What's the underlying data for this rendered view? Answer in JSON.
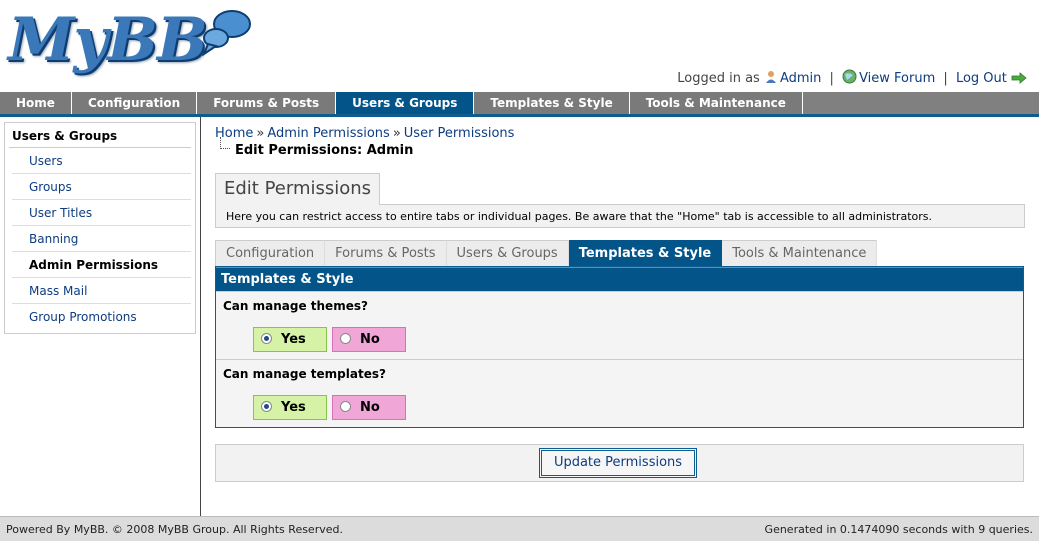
{
  "header": {
    "logo_text": "MyBB",
    "logged_in_as": "Logged in as",
    "user_link": "Admin",
    "view_forum": "View Forum",
    "log_out": "Log Out",
    "separator": "|"
  },
  "menu": {
    "items": [
      {
        "label": "Home"
      },
      {
        "label": "Configuration"
      },
      {
        "label": "Forums & Posts"
      },
      {
        "label": "Users & Groups"
      },
      {
        "label": "Templates & Style"
      },
      {
        "label": "Tools & Maintenance"
      }
    ],
    "active": "Users & Groups"
  },
  "sidebar": {
    "title": "Users & Groups",
    "items": [
      {
        "label": "Users"
      },
      {
        "label": "Groups"
      },
      {
        "label": "User Titles"
      },
      {
        "label": "Banning"
      },
      {
        "label": "Admin Permissions"
      },
      {
        "label": "Mass Mail"
      },
      {
        "label": "Group Promotions"
      }
    ],
    "active": "Admin Permissions"
  },
  "breadcrumb": {
    "items": [
      "Home",
      "Admin Permissions",
      "User Permissions"
    ],
    "separator": "»",
    "current": "Edit Permissions: Admin"
  },
  "page": {
    "title": "Edit Permissions",
    "description": "Here you can restrict access to entire tabs or individual pages. Be aware that the \"Home\" tab is accessible to all administrators."
  },
  "tabs": {
    "items": [
      {
        "label": "Configuration"
      },
      {
        "label": "Forums & Posts"
      },
      {
        "label": "Users & Groups"
      },
      {
        "label": "Templates & Style"
      },
      {
        "label": "Tools & Maintenance"
      }
    ],
    "active": "Templates & Style"
  },
  "permissions": {
    "section_title": "Templates & Style",
    "rows": [
      {
        "label": "Can manage themes?",
        "yes": "Yes",
        "no": "No",
        "selected": "Yes"
      },
      {
        "label": "Can manage templates?",
        "yes": "Yes",
        "no": "No",
        "selected": "Yes"
      }
    ]
  },
  "submit": {
    "label": "Update Permissions"
  },
  "footer": {
    "left": "Powered By MyBB. © 2008 MyBB Group. All Rights Reserved.",
    "right": "Generated in 0.1474090 seconds with 9 queries."
  },
  "colors": {
    "accent": "#035488",
    "link": "#0d3d80",
    "yes_bg": "#d6f2a6",
    "no_bg": "#f1a6d8"
  },
  "icons": [
    "user-icon",
    "globe-icon",
    "logout-arrow-icon",
    "speech-bubble-icon"
  ]
}
